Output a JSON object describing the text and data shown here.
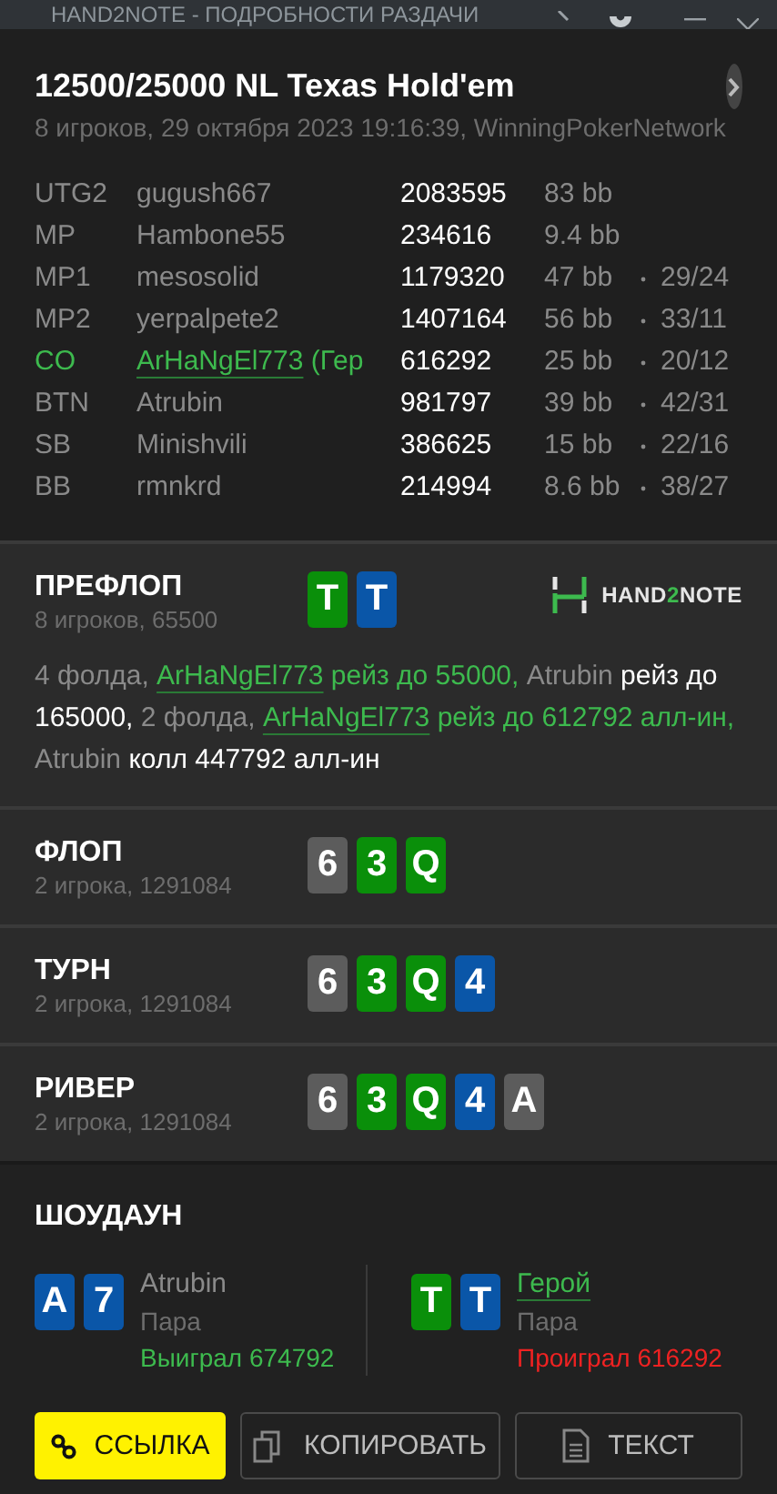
{
  "window": {
    "title": "HAND2NOTE - ПОДРОБНОСТИ РАЗДАЧИ"
  },
  "header": {
    "title": "12500/25000 NL Texas Hold'em",
    "subtitle": "8 игроков, 29 октября 2023 19:16:39, WinningPokerNetwork"
  },
  "players": [
    {
      "position": "UTG2",
      "name": "gugush667",
      "stack": "2083595",
      "bb": "83 bb",
      "hero": false
    },
    {
      "position": "MP",
      "name": "Hambone55",
      "stack": "234616",
      "bb": "9.4 bb",
      "hero": false
    },
    {
      "position": "MP1",
      "name": "mesosolid",
      "stack": "1179320",
      "bb": "47 bb",
      "stats": "29/24",
      "hero": false
    },
    {
      "position": "MP2",
      "name": "yerpalpete2",
      "stack": "1407164",
      "bb": "56 bb",
      "stats": "33/11",
      "hero": false
    },
    {
      "position": "CO",
      "name": "ArHaNgEl773",
      "suffix": "(Гер",
      "stack": "616292",
      "bb": "25 bb",
      "stats": "20/12",
      "hero": true
    },
    {
      "position": "BTN",
      "name": "Atrubin",
      "stack": "981797",
      "bb": "39 bb",
      "stats": "42/31",
      "hero": false
    },
    {
      "position": "SB",
      "name": "Minishvili",
      "stack": "386625",
      "bb": "15 bb",
      "stats": "22/16",
      "hero": false
    },
    {
      "position": "BB",
      "name": "rmnkrd",
      "stack": "214994",
      "bb": "8.6 bb",
      "stats": "38/27",
      "hero": false
    }
  ],
  "streets": [
    {
      "name": "ПРЕФЛОП",
      "info": "8 игроков, 65500",
      "cards": [
        {
          "rank": "T",
          "color": "#0a8f0a"
        },
        {
          "rank": "T",
          "color": "#0a56a8"
        }
      ],
      "logo": [
        {
          "text": "HAND",
          "kind": "plain"
        },
        {
          "text": "2",
          "kind": "accent"
        },
        {
          "text": "NOTE",
          "kind": "plain"
        }
      ],
      "actions": [
        {
          "text": "4 фолда, ",
          "kind": "muted"
        },
        {
          "text": "ArHaNgEl773",
          "kind": "hero-link"
        },
        {
          "text": " рейз до 55000, ",
          "kind": "hero"
        },
        {
          "text": "Atrubin",
          "kind": "muted"
        },
        {
          "text": " рейз до 165000, ",
          "kind": "action"
        },
        {
          "text": "2 фолда, ",
          "kind": "muted"
        },
        {
          "text": "ArHaNgEl773",
          "kind": "hero-link"
        },
        {
          "text": " рейз до 612792 алл-ин, ",
          "kind": "hero"
        },
        {
          "text": "Atrubin",
          "kind": "muted"
        },
        {
          "text": " колл 447792 алл-ин",
          "kind": "action"
        }
      ]
    },
    {
      "name": "ФЛОП",
      "info": "2 игрока, 1291084",
      "cards": [
        {
          "rank": "6",
          "color": "#5c5c5c"
        },
        {
          "rank": "3",
          "color": "#0a8f0a"
        },
        {
          "rank": "Q",
          "color": "#0a8f0a"
        }
      ]
    },
    {
      "name": "ТУРН",
      "info": "2 игрока, 1291084",
      "cards": [
        {
          "rank": "6",
          "color": "#5c5c5c"
        },
        {
          "rank": "3",
          "color": "#0a8f0a"
        },
        {
          "rank": "Q",
          "color": "#0a8f0a"
        },
        {
          "rank": "4",
          "color": "#0a56a8"
        }
      ]
    },
    {
      "name": "РИВЕР",
      "info": "2 игрока, 1291084",
      "cards": [
        {
          "rank": "6",
          "color": "#5c5c5c"
        },
        {
          "rank": "3",
          "color": "#0a8f0a"
        },
        {
          "rank": "Q",
          "color": "#0a8f0a"
        },
        {
          "rank": "4",
          "color": "#0a56a8"
        },
        {
          "rank": "A",
          "color": "#5c5c5c"
        }
      ]
    }
  ],
  "showdown": {
    "title": "ШОУДАУН",
    "hands": [
      {
        "cards": [
          {
            "rank": "A",
            "color": "#0a56a8"
          },
          {
            "rank": "7",
            "color": "#0a56a8"
          }
        ],
        "name": "Atrubin",
        "hero": false,
        "hand": "Пара",
        "result": "Выиграл 674792",
        "won": true
      },
      {
        "cards": [
          {
            "rank": "T",
            "color": "#0a8f0a"
          },
          {
            "rank": "T",
            "color": "#0a56a8"
          }
        ],
        "name": "Герой",
        "hero": true,
        "hand": "Пара",
        "result": "Проиграл 616292",
        "won": false
      }
    ]
  },
  "buttons": [
    {
      "label": "ССЫЛКА",
      "kind": "link"
    },
    {
      "label": "КОПИРОВАТЬ",
      "kind": "copy"
    },
    {
      "label": "ТЕКСТ",
      "kind": "text"
    }
  ]
}
